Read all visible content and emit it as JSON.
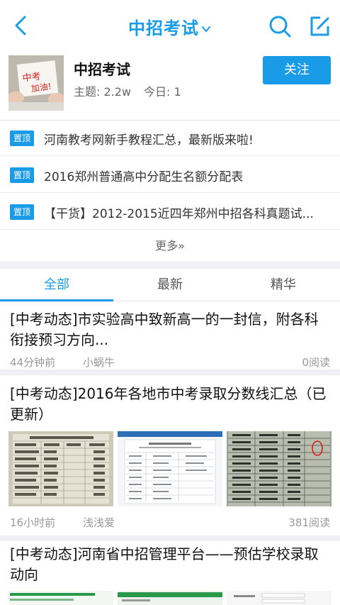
{
  "nav": {
    "title": "中招考试",
    "back_icon": "back-arrow-icon",
    "dropdown_icon": "chevron-down-icon",
    "search_icon": "search-icon",
    "compose_icon": "compose-icon",
    "accent": "#1a9be8"
  },
  "forum": {
    "name": "中招考试",
    "topics_label": "主题: 2.2w",
    "today_label": "今日: 1",
    "follow_label": "关注",
    "thumb_text": "中考加油!"
  },
  "pinned": [
    {
      "badge": "置顶",
      "title": "河南教考网新手教程汇总，最新版来啦!"
    },
    {
      "badge": "置顶",
      "title": "2016郑州普通高中分配生名额分配表"
    },
    {
      "badge": "置顶",
      "title": "【干货】2012-2015近四年郑州中招各科真题试..."
    }
  ],
  "more_label": "更多»",
  "tabs": [
    {
      "label": "全部",
      "active": true
    },
    {
      "label": "最新",
      "active": false
    },
    {
      "label": "精华",
      "active": false
    }
  ],
  "posts": [
    {
      "title": "[中考动态]市实验高中致新高一的一封信，附各科衔接预习方向...",
      "time": "44分钟前",
      "author": "小蜗牛",
      "reads": "0阅读"
    },
    {
      "title": "[中考动态]2016年各地市中考录取分数线汇总（已更新）",
      "time": "16小时前",
      "author": "浅浅爱",
      "reads": "381阅读"
    },
    {
      "title": "[中考动态]河南省中招管理平台——预估学校录取动向"
    }
  ]
}
